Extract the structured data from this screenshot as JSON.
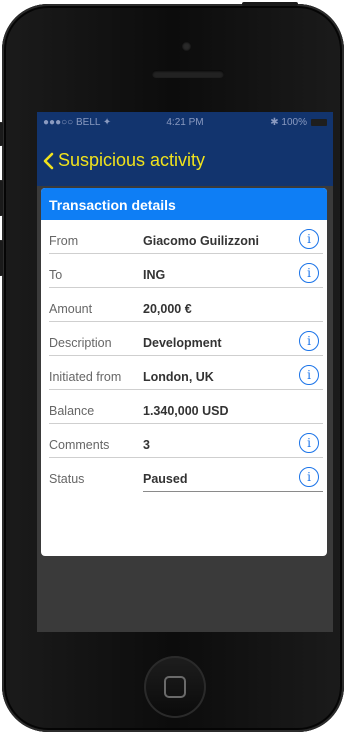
{
  "status_bar": {
    "carrier": "●●●○○ BELL ✦",
    "time": "4:21 PM",
    "battery": "✱ 100%"
  },
  "nav": {
    "back_label": "Suspicious activity"
  },
  "card": {
    "title": "Transaction details",
    "rows": [
      {
        "label": "From",
        "value": "Giacomo Guilizzoni",
        "info": true
      },
      {
        "label": "To",
        "value": "ING",
        "info": true
      },
      {
        "label": "Amount",
        "value": "20,000 €",
        "info": false
      },
      {
        "label": "Description",
        "value": "Development",
        "info": true
      },
      {
        "label": "Initiated from",
        "value": "London, UK",
        "info": true
      },
      {
        "label": "Balance",
        "value": "1.340,000 USD",
        "info": false
      },
      {
        "label": "Comments",
        "value": "3",
        "info": true
      },
      {
        "label": "Status",
        "value": "Paused",
        "info": true
      }
    ],
    "info_glyph": "i"
  }
}
